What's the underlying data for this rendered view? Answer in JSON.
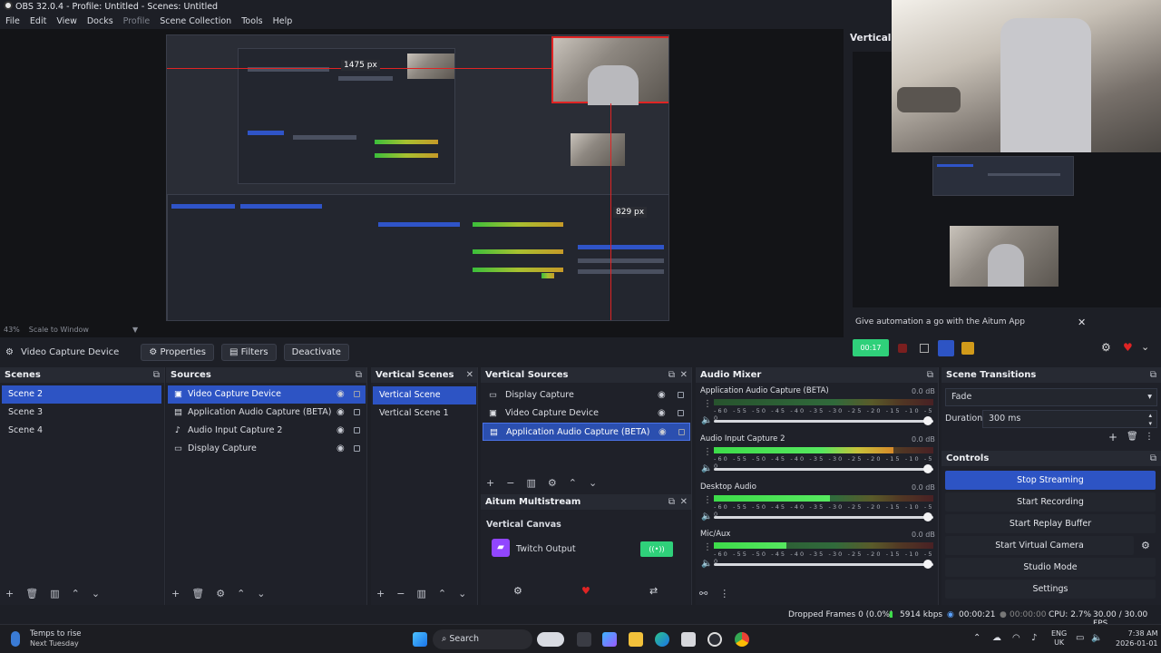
{
  "window": {
    "title": "OBS 32.0.4 - Profile: Untitled - Scenes: Untitled"
  },
  "menu": [
    "File",
    "Edit",
    "View",
    "Docks",
    "Profile",
    "Scene Collection",
    "Tools",
    "Help"
  ],
  "preview": {
    "dimension_horizontal": "1475 px",
    "dimension_vertical": "829 px",
    "zoom_label": "43%",
    "scale_label": "Scale to Window"
  },
  "vertical_panel": {
    "title": "Vertical",
    "automation_text": "Give automation a go with the Aitum App",
    "live_time": "00:17"
  },
  "context_bar": {
    "source_name": "Video Capture Device",
    "properties_label": "Properties",
    "filters_label": "Filters",
    "deactivate_label": "Deactivate"
  },
  "scenes": {
    "title": "Scenes",
    "items": [
      "Scene 2",
      "Scene 3",
      "Scene 4"
    ],
    "selected": 0
  },
  "sources": {
    "title": "Sources",
    "items": [
      {
        "label": "Video Capture Device",
        "icon": "camera-icon"
      },
      {
        "label": "Application Audio Capture (BETA)",
        "icon": "app-audio-icon"
      },
      {
        "label": "Audio Input Capture 2",
        "icon": "microphone-icon"
      },
      {
        "label": "Display Capture",
        "icon": "monitor-icon"
      }
    ],
    "selected": 0
  },
  "vertical_scenes": {
    "title": "Vertical Scenes",
    "items": [
      "Vertical Scene",
      "Vertical Scene 1"
    ],
    "selected": 0
  },
  "vertical_sources": {
    "title": "Vertical Sources",
    "items": [
      {
        "label": "Display Capture",
        "icon": "monitor-icon"
      },
      {
        "label": "Video Capture Device",
        "icon": "camera-icon"
      },
      {
        "label": "Application Audio Capture (BETA)",
        "icon": "app-audio-icon"
      }
    ],
    "selected": 2
  },
  "aitum": {
    "title": "Aitum Multistream",
    "canvas_label": "Vertical Canvas",
    "output_label": "Twitch Output"
  },
  "audio_mixer": {
    "title": "Audio Mixer",
    "ticks": "-60 -55 -50 -45 -40 -35 -30 -25 -20 -15 -10 -5 0",
    "channels": [
      {
        "name": "Application Audio Capture (BETA)",
        "db": "0.0 dB",
        "level": 0.0
      },
      {
        "name": "Audio Input Capture 2",
        "db": "0.0 dB",
        "level": 0.82
      },
      {
        "name": "Desktop Audio",
        "db": "0.0 dB",
        "level": 0.53
      },
      {
        "name": "Mic/Aux",
        "db": "0.0 dB",
        "level": 0.33
      }
    ]
  },
  "transitions": {
    "title": "Scene Transitions",
    "selected": "Fade",
    "duration_label": "Duration",
    "duration_value": "300 ms"
  },
  "controls": {
    "title": "Controls",
    "buttons": [
      "Stop Streaming",
      "Start Recording",
      "Start Replay Buffer",
      "Start Virtual Camera",
      "Studio Mode",
      "Settings"
    ],
    "active": 0
  },
  "status": {
    "dropped": "Dropped Frames 0 (0.0%)",
    "bitrate": "5914 kbps",
    "stream_time": "00:00:21",
    "rec_time": "00:00:00",
    "cpu": "CPU: 2.7%",
    "fps": "30.00 / 30.00 FPS"
  },
  "taskbar": {
    "weather_title": "Temps to rise",
    "weather_sub": "Next Tuesday",
    "search": "Search",
    "lang_top": "ENG",
    "lang_bottom": "UK",
    "time": "7:38 AM",
    "date": "2026-01-01"
  },
  "colors": {
    "accent": "#2d54c4",
    "live_green": "#2fd07a",
    "dock_bg": "#1f2129",
    "header_bg": "#272a33"
  }
}
